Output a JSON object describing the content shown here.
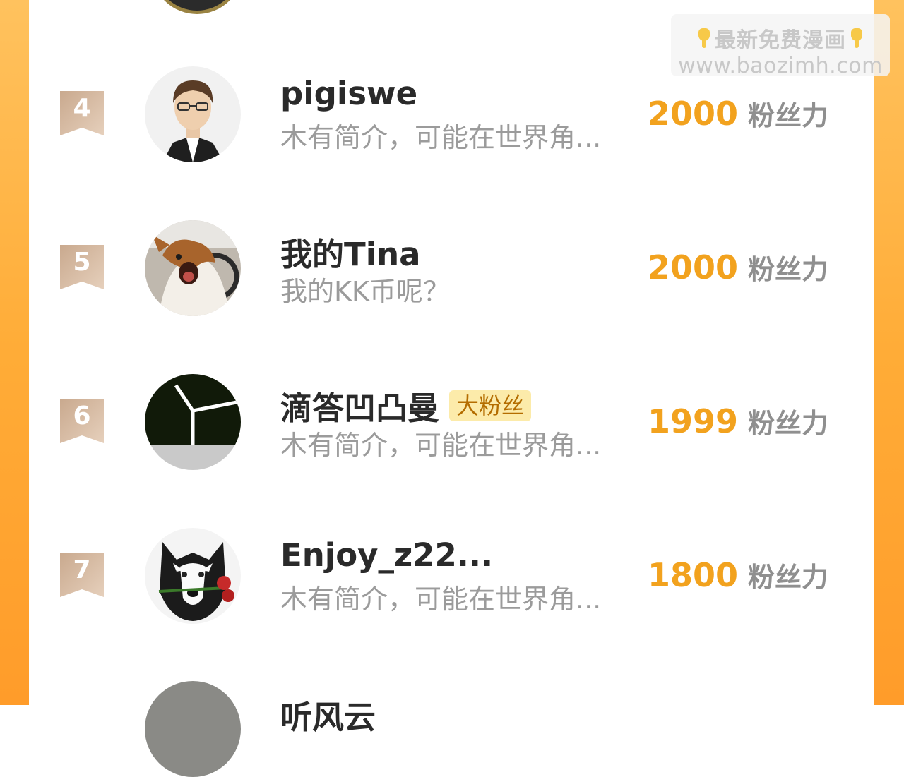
{
  "watermark": {
    "line1": "最新免费漫画",
    "line2": "www.baozimh.com"
  },
  "ranking": [
    {
      "rank": "4",
      "name": "pigiswe",
      "tag": "",
      "bio": "木有简介，可能在世界角...",
      "score": "2000",
      "unit": "粉丝力",
      "avatar": "cartoon-man-with-glasses-avatar"
    },
    {
      "rank": "5",
      "name": "我的Tina",
      "tag": "",
      "bio": "我的KK币呢？",
      "score": "2000",
      "unit": "粉丝力",
      "avatar": "corgi-driving-avatar"
    },
    {
      "rank": "6",
      "name": "滴答凹凸曼",
      "tag": "大粉丝",
      "bio": "木有简介，可能在世界角...",
      "score": "1999",
      "unit": "粉丝力",
      "avatar": "abstract-dark-logo-avatar"
    },
    {
      "rank": "7",
      "name": "Enjoy_z22...",
      "tag": "",
      "bio": "木有简介，可能在世界角...",
      "score": "1800",
      "unit": "粉丝力",
      "avatar": "husky-with-rose-avatar"
    }
  ],
  "partial_next": {
    "name": "听风云"
  },
  "colors": {
    "frame_orange": "#ffac37",
    "score_orange": "#f2a21e",
    "badge_tan": "#d4b8a0",
    "tag_bg": "#fcebaa"
  }
}
